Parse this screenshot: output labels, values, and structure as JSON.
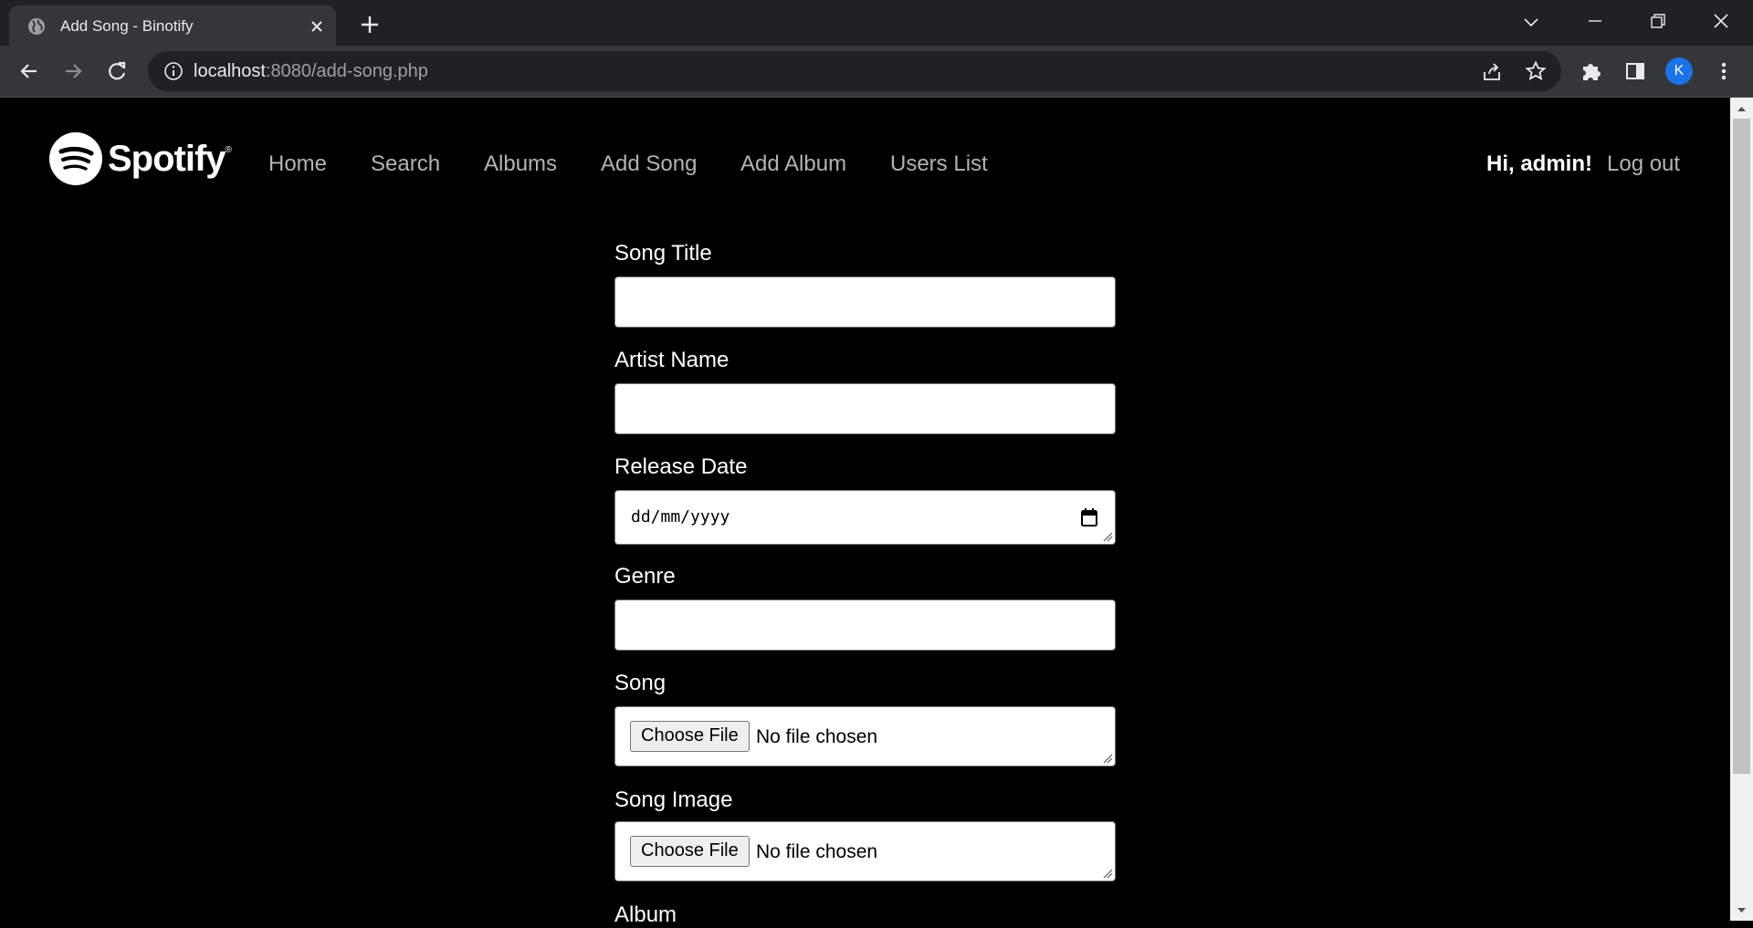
{
  "browser": {
    "tab_title": "Add Song - Binotify",
    "url_host": "localhost",
    "url_rest": ":8080/add-song.php",
    "profile_initial": "K",
    "accent_color": "#1a73e8"
  },
  "header": {
    "logo_text": "Spotify",
    "logo_reg": "®",
    "nav": [
      "Home",
      "Search",
      "Albums",
      "Add Song",
      "Add Album",
      "Users List"
    ],
    "greeting": "Hi, admin!",
    "logout": "Log out"
  },
  "form": {
    "song_title_label": "Song Title",
    "song_title_value": "",
    "artist_name_label": "Artist Name",
    "artist_name_value": "",
    "release_date_label": "Release Date",
    "release_date_placeholder": "dd/mm/yyyy",
    "genre_label": "Genre",
    "genre_value": "",
    "song_label": "Song",
    "song_button": "Choose File",
    "song_status": "No file chosen",
    "song_image_label": "Song Image",
    "song_image_button": "Choose File",
    "song_image_status": "No file chosen",
    "album_label": "Album"
  },
  "icons": {
    "favicon": "globe-icon",
    "tab_close": "close-icon",
    "new_tab": "plus-icon",
    "back": "arrow-left-icon",
    "forward": "arrow-right-icon",
    "reload": "reload-icon",
    "site_info": "info-icon",
    "share": "share-icon",
    "bookmark": "star-icon",
    "extensions": "puzzle-icon",
    "side_panel": "side-panel-icon",
    "menu": "kebab-menu-icon",
    "calendar": "calendar-icon"
  }
}
